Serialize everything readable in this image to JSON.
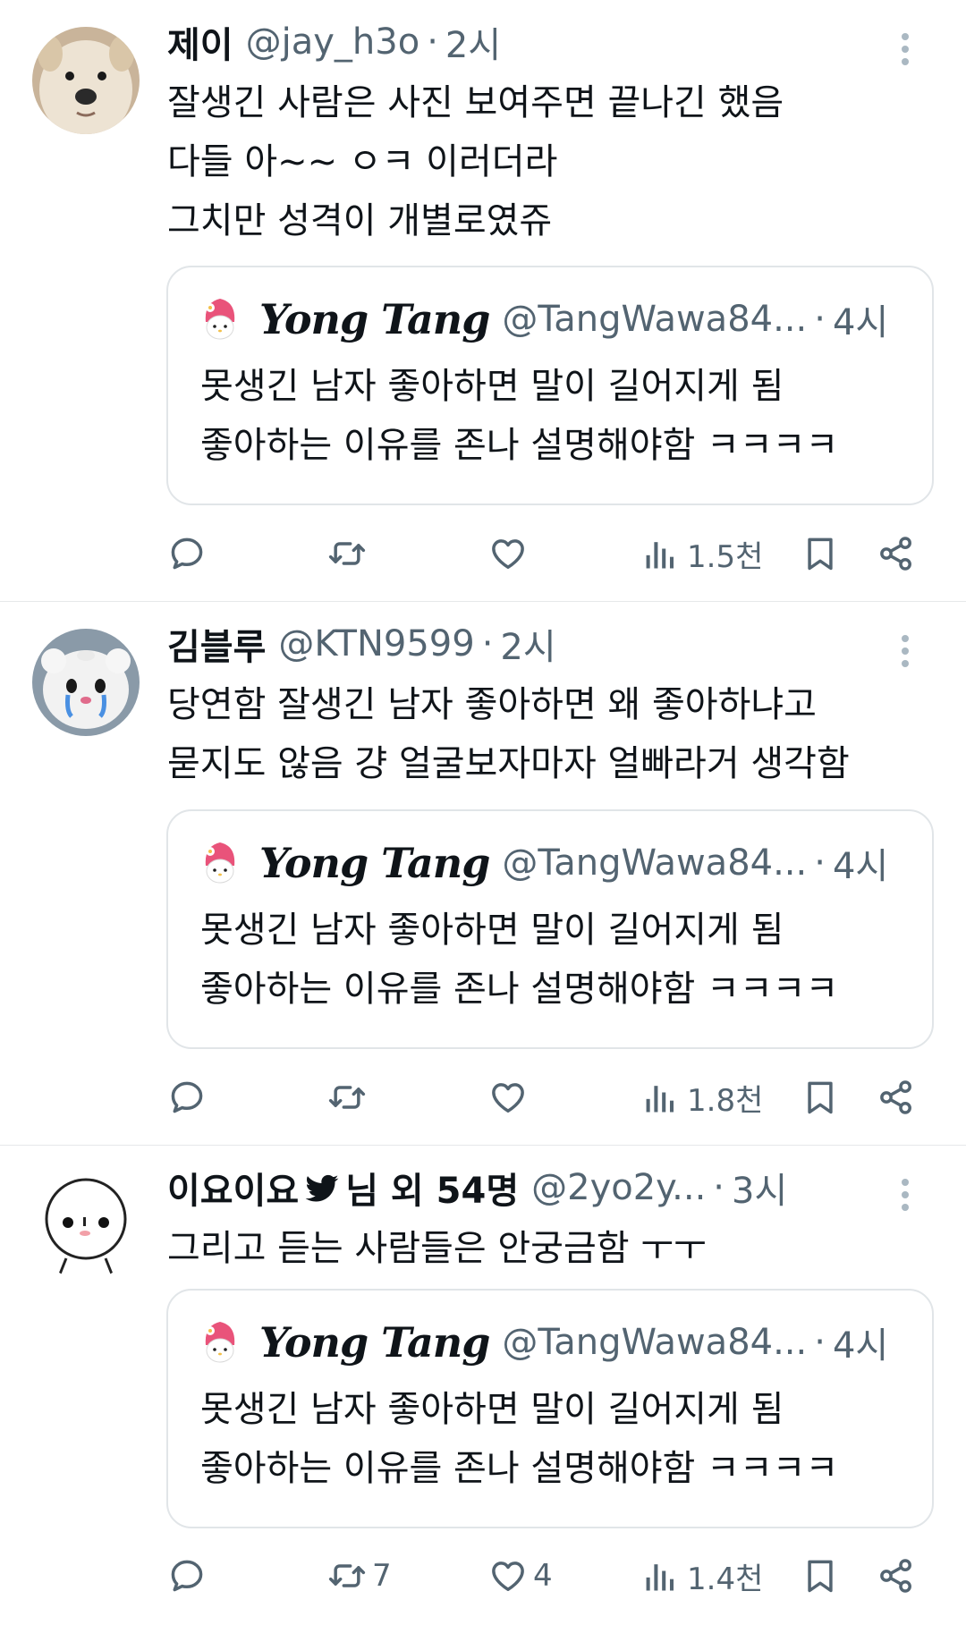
{
  "tweets": [
    {
      "name": "제이",
      "handle": "@jay_h3o",
      "sep": "·",
      "time": "2시",
      "lines": [
        "잘생긴 사람은 사진 보여주면 끝나긴 했음",
        "다들 아~~ ㅇㅋ 이러더라",
        "그치만 성격이 개별로였쥬"
      ],
      "quote": {
        "name": "Yong Tang",
        "handle": "@TangWawa84...",
        "sep": "·",
        "time": "4시",
        "lines": [
          "못생긴 남자 좋아하면 말이 길어지게 됨",
          "좋아하는 이유를 존나 설명해야함 ㅋㅋㅋㅋ"
        ]
      },
      "actions": {
        "views": "1.5천"
      }
    },
    {
      "name": "김블루",
      "handle": "@KTN9599",
      "sep": "·",
      "time": "2시",
      "lines": [
        "당연함 잘생긴 남자 좋아하면 왜 좋아하냐고",
        "묻지도 않음 걍 얼굴보자마자 얼빠라거 생각함"
      ],
      "quote": {
        "name": "Yong Tang",
        "handle": "@TangWawa84...",
        "sep": "·",
        "time": "4시",
        "lines": [
          "못생긴 남자 좋아하면 말이 길어지게 됨",
          "좋아하는 이유를 존나 설명해야함 ㅋㅋㅋㅋ"
        ]
      },
      "actions": {
        "views": "1.8천"
      }
    },
    {
      "name": "이요이요",
      "name_suffix": "님 외 54명",
      "handle": "@2yo2y...",
      "sep": "·",
      "time": "3시",
      "lines": [
        "그리고 듣는 사람들은 안궁금함 ㅜㅜ"
      ],
      "quote": {
        "name": "Yong Tang",
        "handle": "@TangWawa84...",
        "sep": "·",
        "time": "4시",
        "lines": [
          "못생긴 남자 좋아하면 말이 길어지게 됨",
          "좋아하는 이유를 존나 설명해야함 ㅋㅋㅋㅋ"
        ]
      },
      "actions": {
        "retweets": "7",
        "likes": "4",
        "views": "1.4천"
      }
    }
  ],
  "icons": {
    "reply": "reply-icon",
    "retweet": "retweet-icon",
    "like": "heart-icon",
    "views": "views-icon",
    "bookmark": "bookmark-icon",
    "share": "share-icon",
    "more": "more-icon",
    "bird": "bird-icon"
  },
  "colors": {
    "text": "#0f1419",
    "secondary": "#536471",
    "border": "#e1e5e8",
    "icon": "#536471"
  }
}
